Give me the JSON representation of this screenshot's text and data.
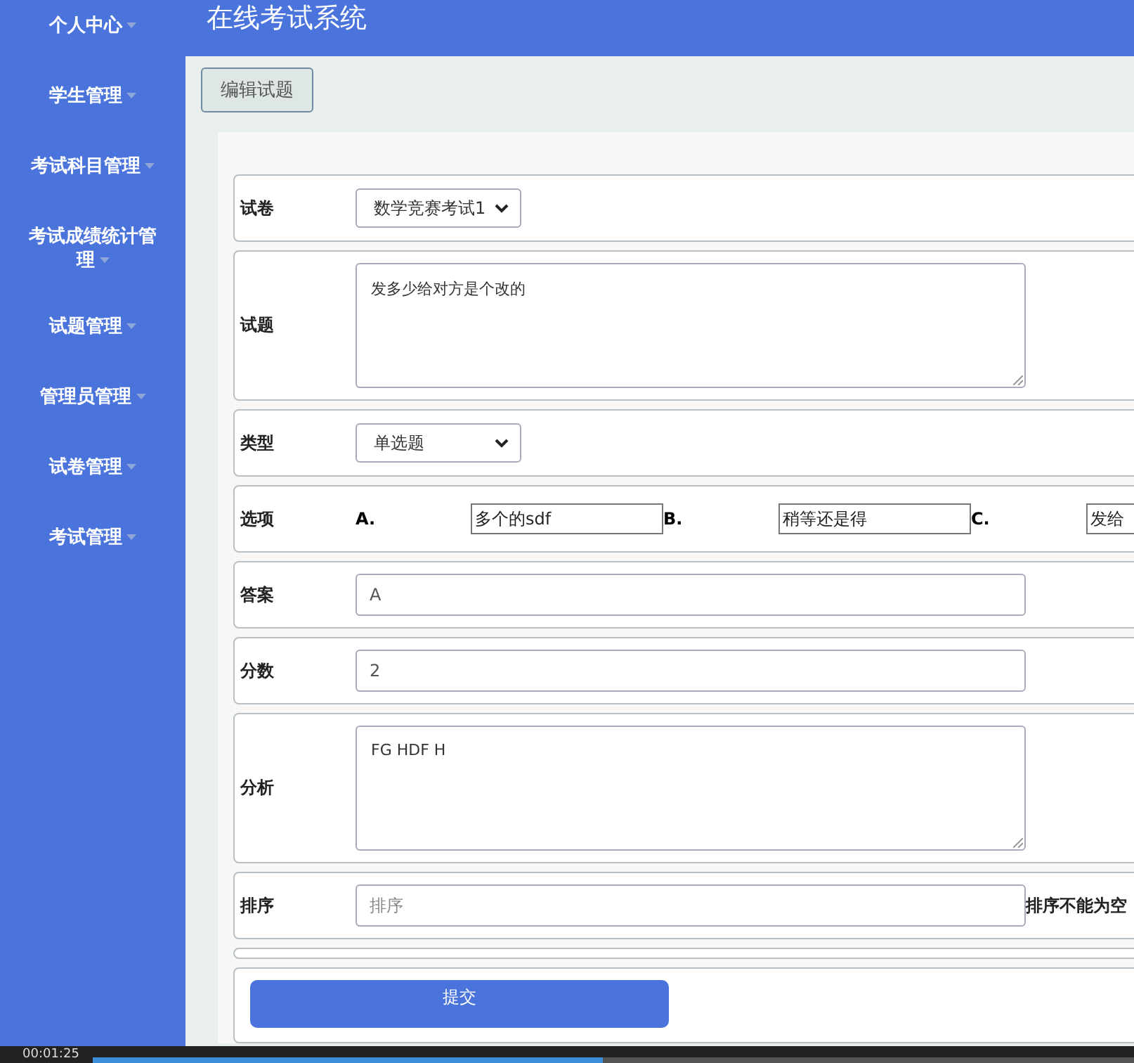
{
  "sidebar": {
    "items": [
      {
        "label": "个人中心"
      },
      {
        "label": "学生管理"
      },
      {
        "label": "考试科目管理"
      },
      {
        "label": "考试成绩统计管理"
      },
      {
        "label": "试题管理"
      },
      {
        "label": "管理员管理"
      },
      {
        "label": "试卷管理"
      },
      {
        "label": "考试管理"
      }
    ]
  },
  "header": {
    "title": "在线考试系统"
  },
  "tab_button": "编辑试题",
  "form": {
    "rows": [
      {
        "kind": "select",
        "label": "试卷",
        "value": "数学竞赛考试1"
      },
      {
        "kind": "textarea",
        "label": "试题",
        "value": "发多少给对方是个改的"
      },
      {
        "kind": "select",
        "label": "类型",
        "value": "单选题"
      },
      {
        "kind": "options",
        "label": "选项",
        "options": [
          {
            "letter": "A.",
            "value": "多个的sdf"
          },
          {
            "letter": "B.",
            "value": "稍等还是得"
          },
          {
            "letter": "C.",
            "value": "发给"
          }
        ]
      },
      {
        "kind": "input",
        "label": "答案",
        "value": "A"
      },
      {
        "kind": "input",
        "label": "分数",
        "value": "2"
      },
      {
        "kind": "textarea",
        "label": "分析",
        "value": "FG HDF H"
      },
      {
        "kind": "input",
        "label": "排序",
        "placeholder": "排序",
        "message": "排序不能为空"
      },
      {
        "kind": "empty"
      }
    ]
  },
  "submit": "提交",
  "player": {
    "time": "00:01:25",
    "level": 0.49
  }
}
